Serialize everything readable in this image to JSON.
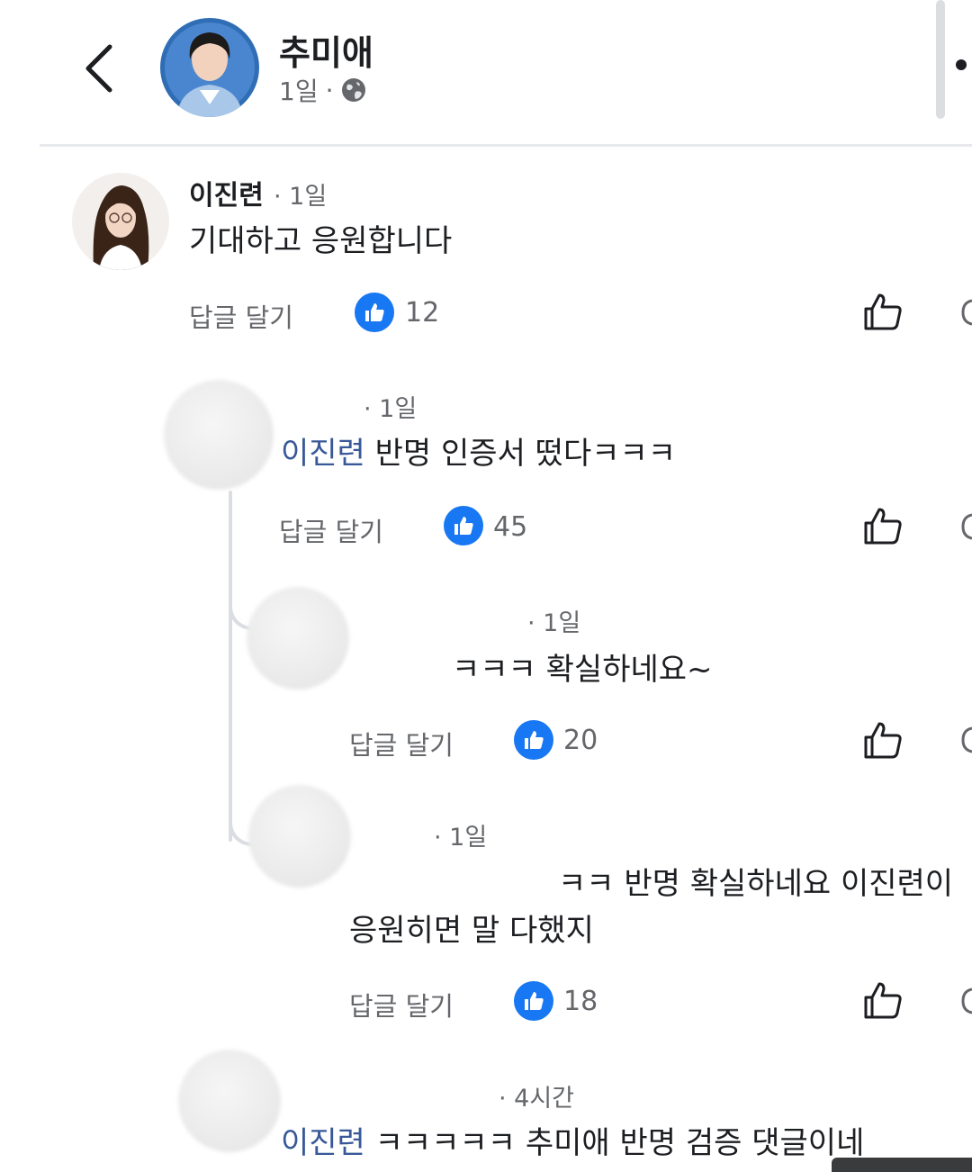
{
  "header": {
    "page_name": "추미애",
    "time": "1일",
    "separator": "·",
    "privacy_icon": "globe-icon",
    "back_icon": "back-chevron-icon"
  },
  "comments": [
    {
      "author": "이진련",
      "time": "· 1일",
      "text": "기대하고 응원합니다",
      "reply_label": "답글 달기",
      "like_count": "12"
    },
    {
      "time": "· 1일",
      "mention": "이진련",
      "text": " 반명 인증서 떴다ㅋㅋㅋ",
      "reply_label": "답글 달기",
      "like_count": "45"
    },
    {
      "time": "· 1일",
      "text": "ㅋㅋㅋ 확실하네요~",
      "reply_label": "답글 달기",
      "like_count": "20"
    },
    {
      "time": "· 1일",
      "text_line1": "ㅋㅋ 반명 확실하네요 이진련이",
      "text_line2": "응원히면 말 다했지",
      "reply_label": "답글 달기",
      "like_count": "18"
    },
    {
      "time": "· 4시간",
      "mention": "이진련",
      "text": " ㅋㅋㅋㅋㅋ 추미애 반명 검증 댓글이네"
    }
  ],
  "colors": {
    "like_blue": "#1877f2",
    "mention_blue": "#385898",
    "secondary_text": "#65676b"
  }
}
